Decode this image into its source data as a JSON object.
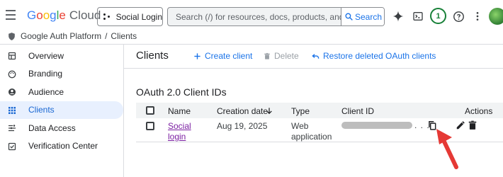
{
  "header": {
    "logo": {
      "google": [
        "G",
        "o",
        "o",
        "g",
        "l",
        "e"
      ],
      "product": "Cloud"
    },
    "project_label": "Social Login",
    "search": {
      "placeholder": "Search (/) for resources, docs, products, and more",
      "button_label": "Search"
    },
    "notification_count": "1"
  },
  "breadcrumb": {
    "items": [
      "Google Auth Platform",
      "Clients"
    ],
    "separator": "/"
  },
  "sidebar": {
    "items": [
      {
        "label": "Overview",
        "icon": "dashboard-icon"
      },
      {
        "label": "Branding",
        "icon": "palette-icon"
      },
      {
        "label": "Audience",
        "icon": "person-circle-icon"
      },
      {
        "label": "Clients",
        "icon": "grid-icon",
        "active": true
      },
      {
        "label": "Data Access",
        "icon": "tune-icon"
      },
      {
        "label": "Verification Center",
        "icon": "verified-icon"
      }
    ]
  },
  "main": {
    "title": "Clients",
    "actions": {
      "create": "Create client",
      "delete": "Delete",
      "restore": "Restore deleted OAuth clients"
    },
    "section_title": "OAuth 2.0 Client IDs",
    "table": {
      "columns": [
        "Name",
        "Creation date",
        "Type",
        "Client ID",
        "Actions"
      ],
      "rows": [
        {
          "name": [
            "Social",
            "login"
          ],
          "creation_date": "Aug 19, 2025",
          "type": [
            "Web",
            "application"
          ],
          "client_id_suffix": ". . ."
        }
      ]
    }
  },
  "colors": {
    "accent": "#1a73e8",
    "active_bg": "#e8f0fe",
    "link_visited": "#7b1fa2",
    "annotation_arrow": "#e53935"
  }
}
